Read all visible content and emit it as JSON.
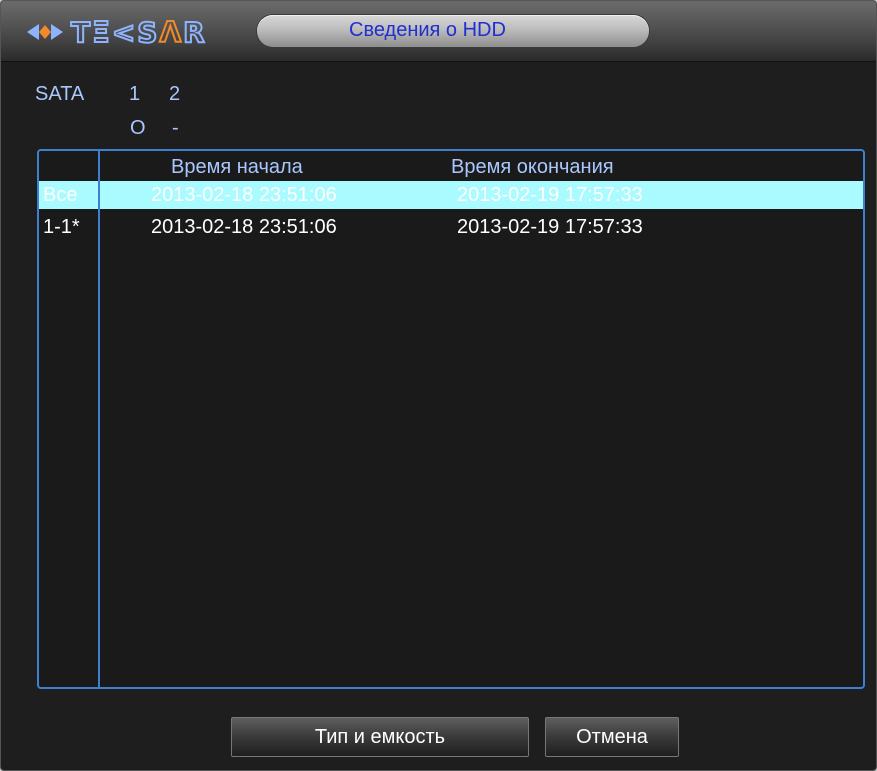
{
  "window": {
    "title": "Сведения о HDD",
    "logo_text": "TEKSAR"
  },
  "sata": {
    "label": "SATA",
    "disks": [
      {
        "number": "1",
        "status": "O"
      },
      {
        "number": "2",
        "status": "-"
      }
    ]
  },
  "table": {
    "columns": [
      "",
      "Время начала",
      "Время окончания"
    ],
    "rows": [
      {
        "id": "Все",
        "start": "2013-02-18 23:51:06",
        "end": "2013-02-19 17:57:33",
        "selected": true
      },
      {
        "id": "1-1*",
        "start": "2013-02-18 23:51:06",
        "end": "2013-02-19 17:57:33",
        "selected": false
      }
    ]
  },
  "buttons": {
    "type_capacity": "Тип и емкость",
    "cancel": "Отмена"
  },
  "colors": {
    "accent_blue": "#3f7fd0",
    "selection": "#a9fbff",
    "title_text": "#1f2fd0",
    "label_text": "#a9c7ff"
  }
}
